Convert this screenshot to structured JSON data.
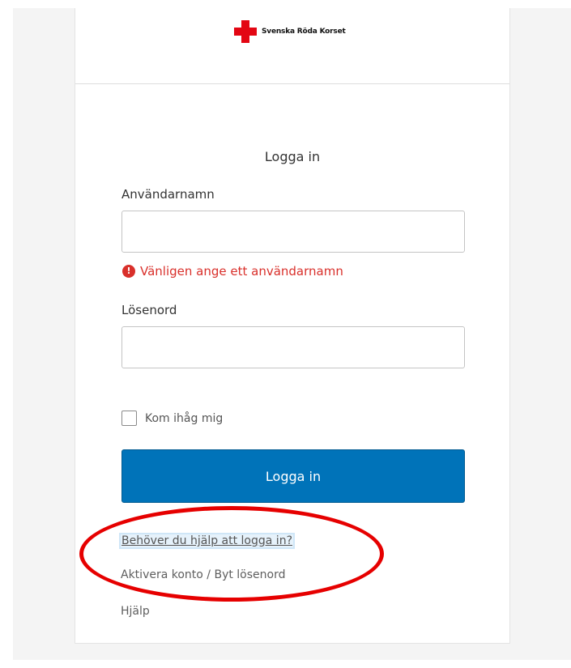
{
  "header": {
    "logo_text": "Svenska Röda Korset"
  },
  "form": {
    "title": "Logga in",
    "username_label": "Användarnamn",
    "username_value": "",
    "username_error": "Vänligen ange ett användarnamn",
    "password_label": "Lösenord",
    "password_value": "",
    "remember_label": "Kom ihåg mig",
    "remember_checked": false,
    "submit_label": "Logga in"
  },
  "links": {
    "need_help": "Behöver du hjälp att logga in?",
    "activate": "Aktivera konto / Byt lösenord",
    "help": "Hjälp"
  },
  "icons": {
    "logo": "red-cross-icon",
    "error": "exclamation-circle-icon",
    "checkbox": "checkbox-icon"
  },
  "colors": {
    "brand_red": "#e30613",
    "button_blue": "#0073b9",
    "error_red": "#d9302b",
    "annotation_red": "#e60000"
  }
}
